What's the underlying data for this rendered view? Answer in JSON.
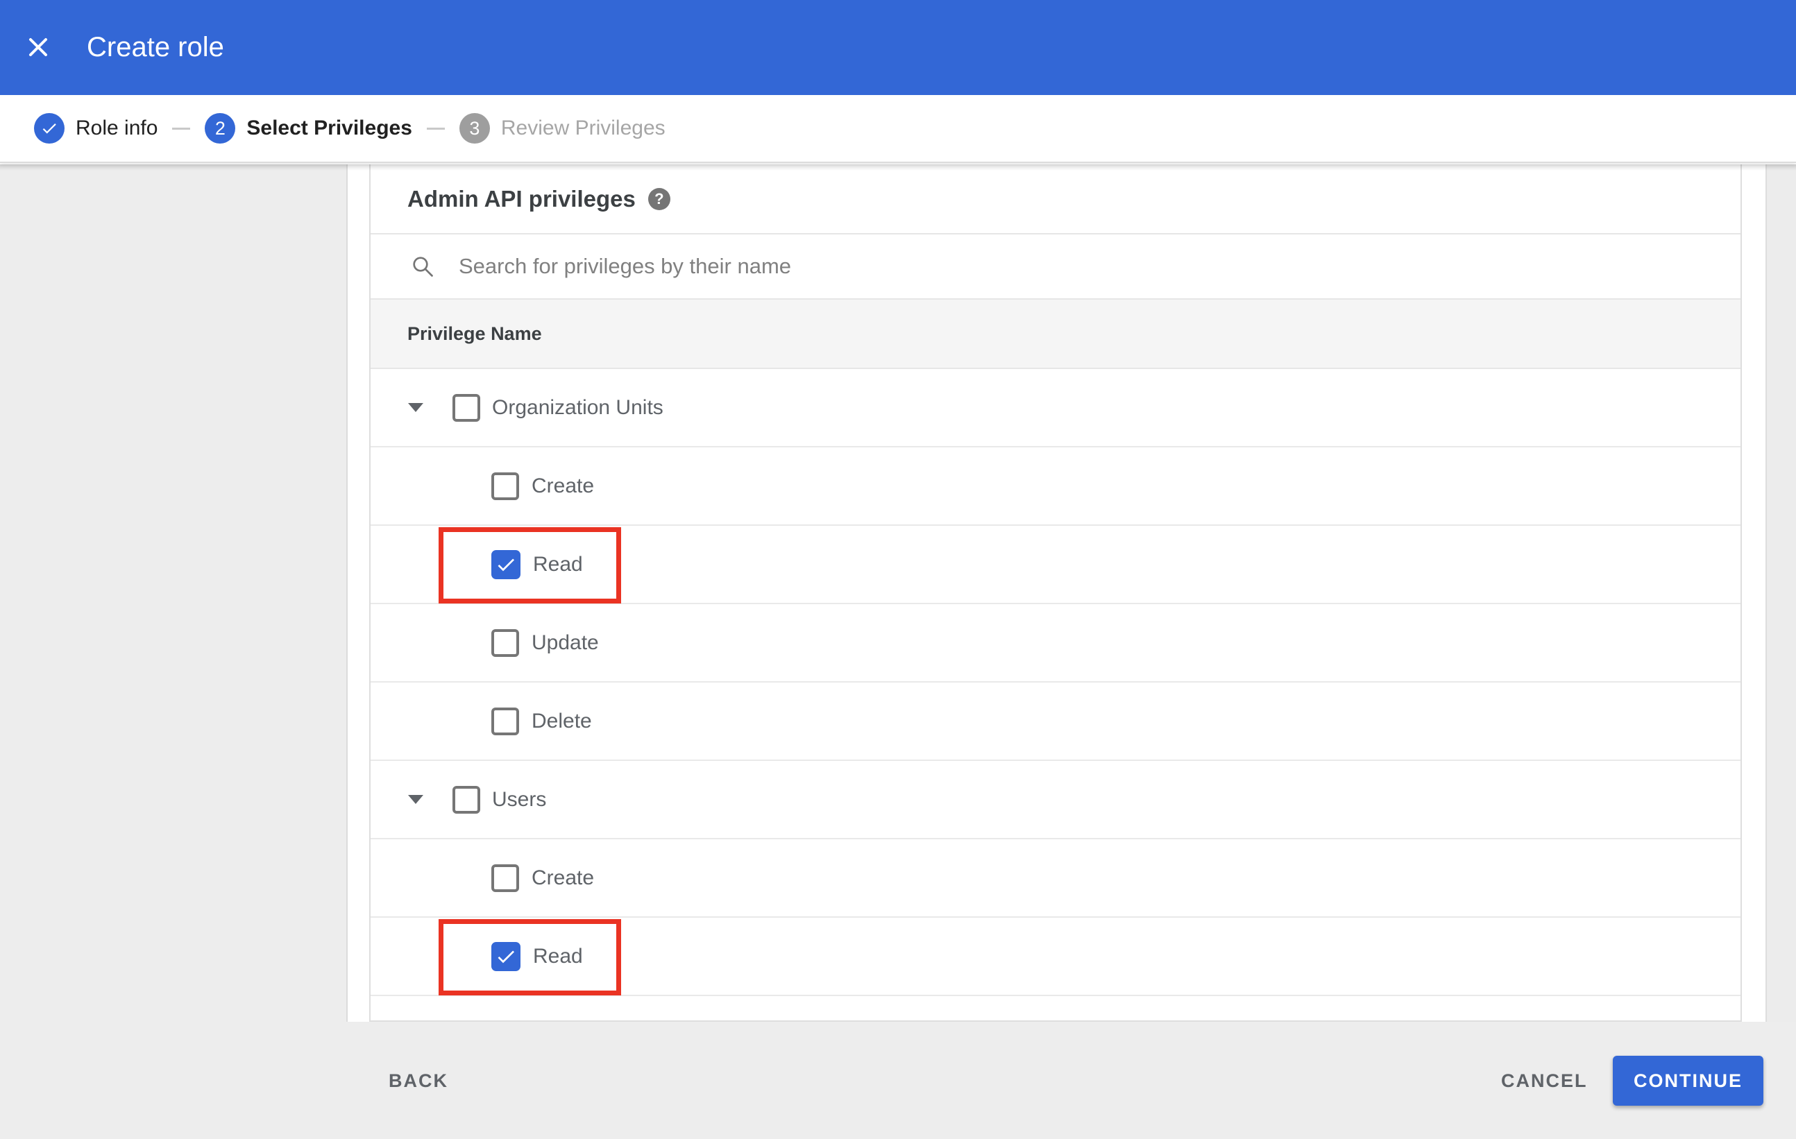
{
  "colors": {
    "primary_blue": "#3367d6",
    "highlight_red": "#ea3323",
    "header_text": "#ffffff",
    "inactive_gray": "#9e9e9e",
    "footer_background": "#ededed"
  },
  "header": {
    "title": "Create role"
  },
  "stepper": {
    "steps": [
      {
        "number": "1",
        "label": "Role info",
        "state": "completed"
      },
      {
        "number": "2",
        "label": "Select Privileges",
        "state": "active"
      },
      {
        "number": "3",
        "label": "Review Privileges",
        "state": "upcoming"
      }
    ]
  },
  "content": {
    "title": "Admin API privileges",
    "help_glyph": "?",
    "search": {
      "placeholder": "Search for privileges by their name",
      "value": ""
    },
    "table": {
      "column_header": "Privilege Name",
      "rows": [
        {
          "label": "Organization Units",
          "level": 0,
          "expandable": true,
          "checked": false,
          "highlighted": false
        },
        {
          "label": "Create",
          "level": 1,
          "expandable": false,
          "checked": false,
          "highlighted": false
        },
        {
          "label": "Read",
          "level": 1,
          "expandable": false,
          "checked": true,
          "highlighted": true
        },
        {
          "label": "Update",
          "level": 1,
          "expandable": false,
          "checked": false,
          "highlighted": false
        },
        {
          "label": "Delete",
          "level": 1,
          "expandable": false,
          "checked": false,
          "highlighted": false
        },
        {
          "label": "Users",
          "level": 0,
          "expandable": true,
          "checked": false,
          "highlighted": false
        },
        {
          "label": "Create",
          "level": 1,
          "expandable": false,
          "checked": false,
          "highlighted": false
        },
        {
          "label": "Read",
          "level": 1,
          "expandable": false,
          "checked": true,
          "highlighted": true
        }
      ]
    }
  },
  "footer": {
    "back": "BACK",
    "cancel": "CANCEL",
    "continue": "CONTINUE"
  }
}
